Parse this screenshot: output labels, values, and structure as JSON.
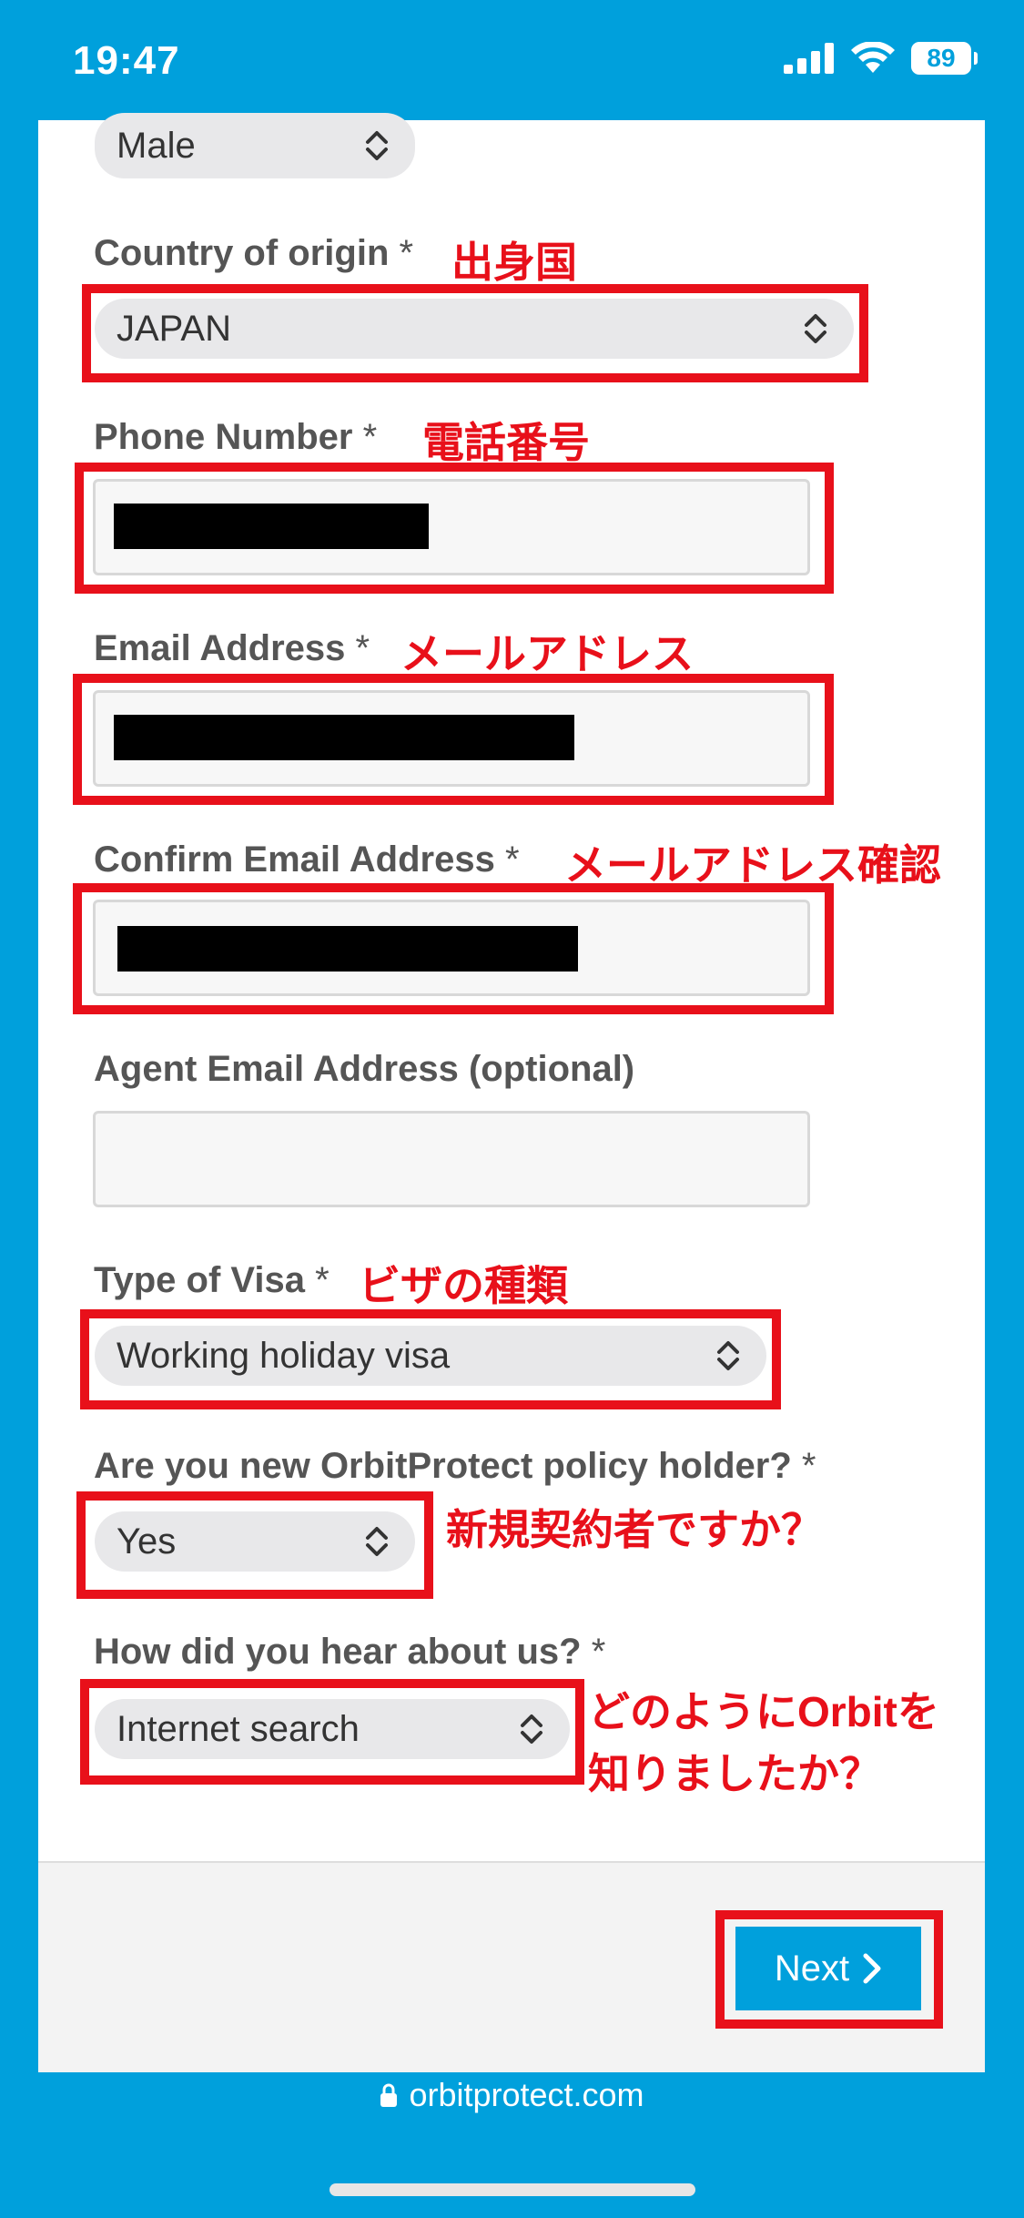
{
  "status_bar": {
    "time": "19:47",
    "battery": "89"
  },
  "form": {
    "gender": {
      "value": "Male"
    },
    "country": {
      "label": "Country of origin",
      "required": "*",
      "note_jp": "出身国",
      "value": "JAPAN"
    },
    "phone": {
      "label": "Phone Number",
      "required": "*",
      "note_jp": "電話番号"
    },
    "email": {
      "label": "Email Address",
      "required": "*",
      "note_jp": "メールアドレス"
    },
    "confirm_email": {
      "label": "Confirm Email Address",
      "required": "*",
      "note_jp": "メールアドレス確認"
    },
    "agent_email": {
      "label": "Agent Email Address (optional)"
    },
    "visa": {
      "label": "Type of Visa",
      "required": "*",
      "note_jp": "ビザの種類",
      "value": "Working holiday visa"
    },
    "new_holder": {
      "label": "Are you new OrbitProtect policy holder?",
      "required": "*",
      "note_jp": "新規契約者ですか？",
      "value": "Yes"
    },
    "hear": {
      "label": "How did you hear about us?",
      "required": "*",
      "note_jp_line1": "どのようにOrbitを",
      "note_jp_line2": "知りましたか？",
      "value": "Internet search"
    }
  },
  "next_button": {
    "label": "Next"
  },
  "browser": {
    "url": "orbitprotect.com"
  },
  "colors": {
    "brand": "#00a0dc",
    "annotation": "#e8101a"
  }
}
